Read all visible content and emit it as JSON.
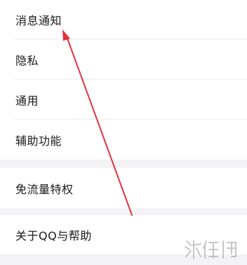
{
  "settings": {
    "group1": [
      {
        "label": "消息通知"
      },
      {
        "label": "隐私"
      },
      {
        "label": "通用"
      },
      {
        "label": "辅助功能"
      }
    ],
    "group2": [
      {
        "label": "免流量特权"
      }
    ],
    "group3": [
      {
        "label": "关于QQ与帮助"
      }
    ]
  },
  "annotation": {
    "arrow_color": "#e5323e"
  },
  "watermark": {
    "text": "游侠网"
  }
}
